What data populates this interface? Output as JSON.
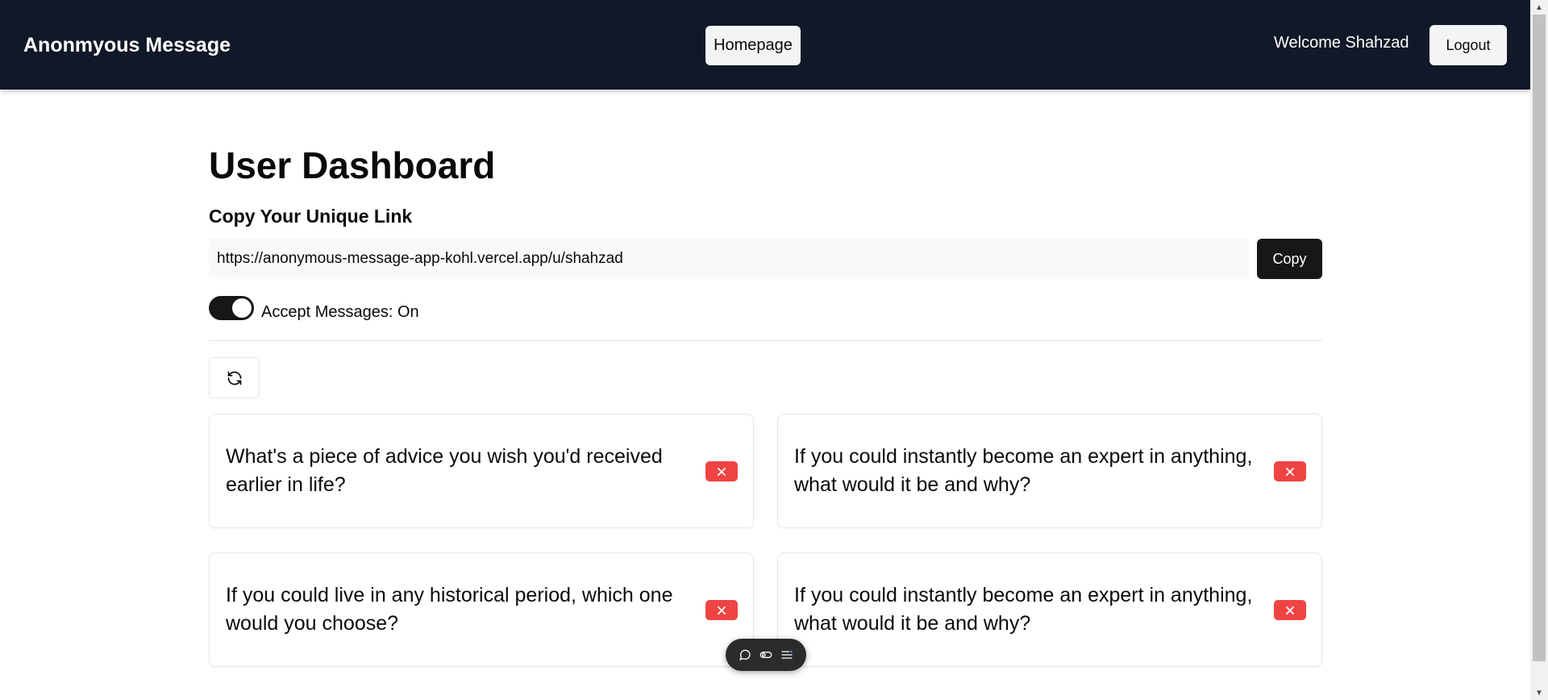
{
  "navbar": {
    "brand": "Anonmyous Message",
    "home_label": "Homepage",
    "welcome": "Welcome Shahzad",
    "logout_label": "Logout"
  },
  "dashboard": {
    "title": "User Dashboard",
    "link_section_label": "Copy Your Unique Link",
    "unique_link": "https://anonymous-message-app-kohl.vercel.app/u/shahzad",
    "copy_label": "Copy",
    "accept_messages_label": "Accept Messages: On",
    "accept_messages_on": true
  },
  "messages": [
    {
      "text": "What's a piece of advice you wish you'd received earlier in life?"
    },
    {
      "text": "If you could instantly become an expert in anything, what would it be and why?"
    },
    {
      "text": "If you could live in any historical period, which one would you choose?"
    },
    {
      "text": "If you could instantly become an expert in anything, what would it be and why?"
    }
  ],
  "icons": {
    "refresh": "refresh-icon",
    "delete": "x-icon",
    "toolbar": [
      "comment-icon",
      "toggle-icon",
      "menu-icon"
    ]
  },
  "colors": {
    "navbar_bg": "#111827",
    "delete_red": "#ef4444",
    "primary_dark": "#171717"
  }
}
